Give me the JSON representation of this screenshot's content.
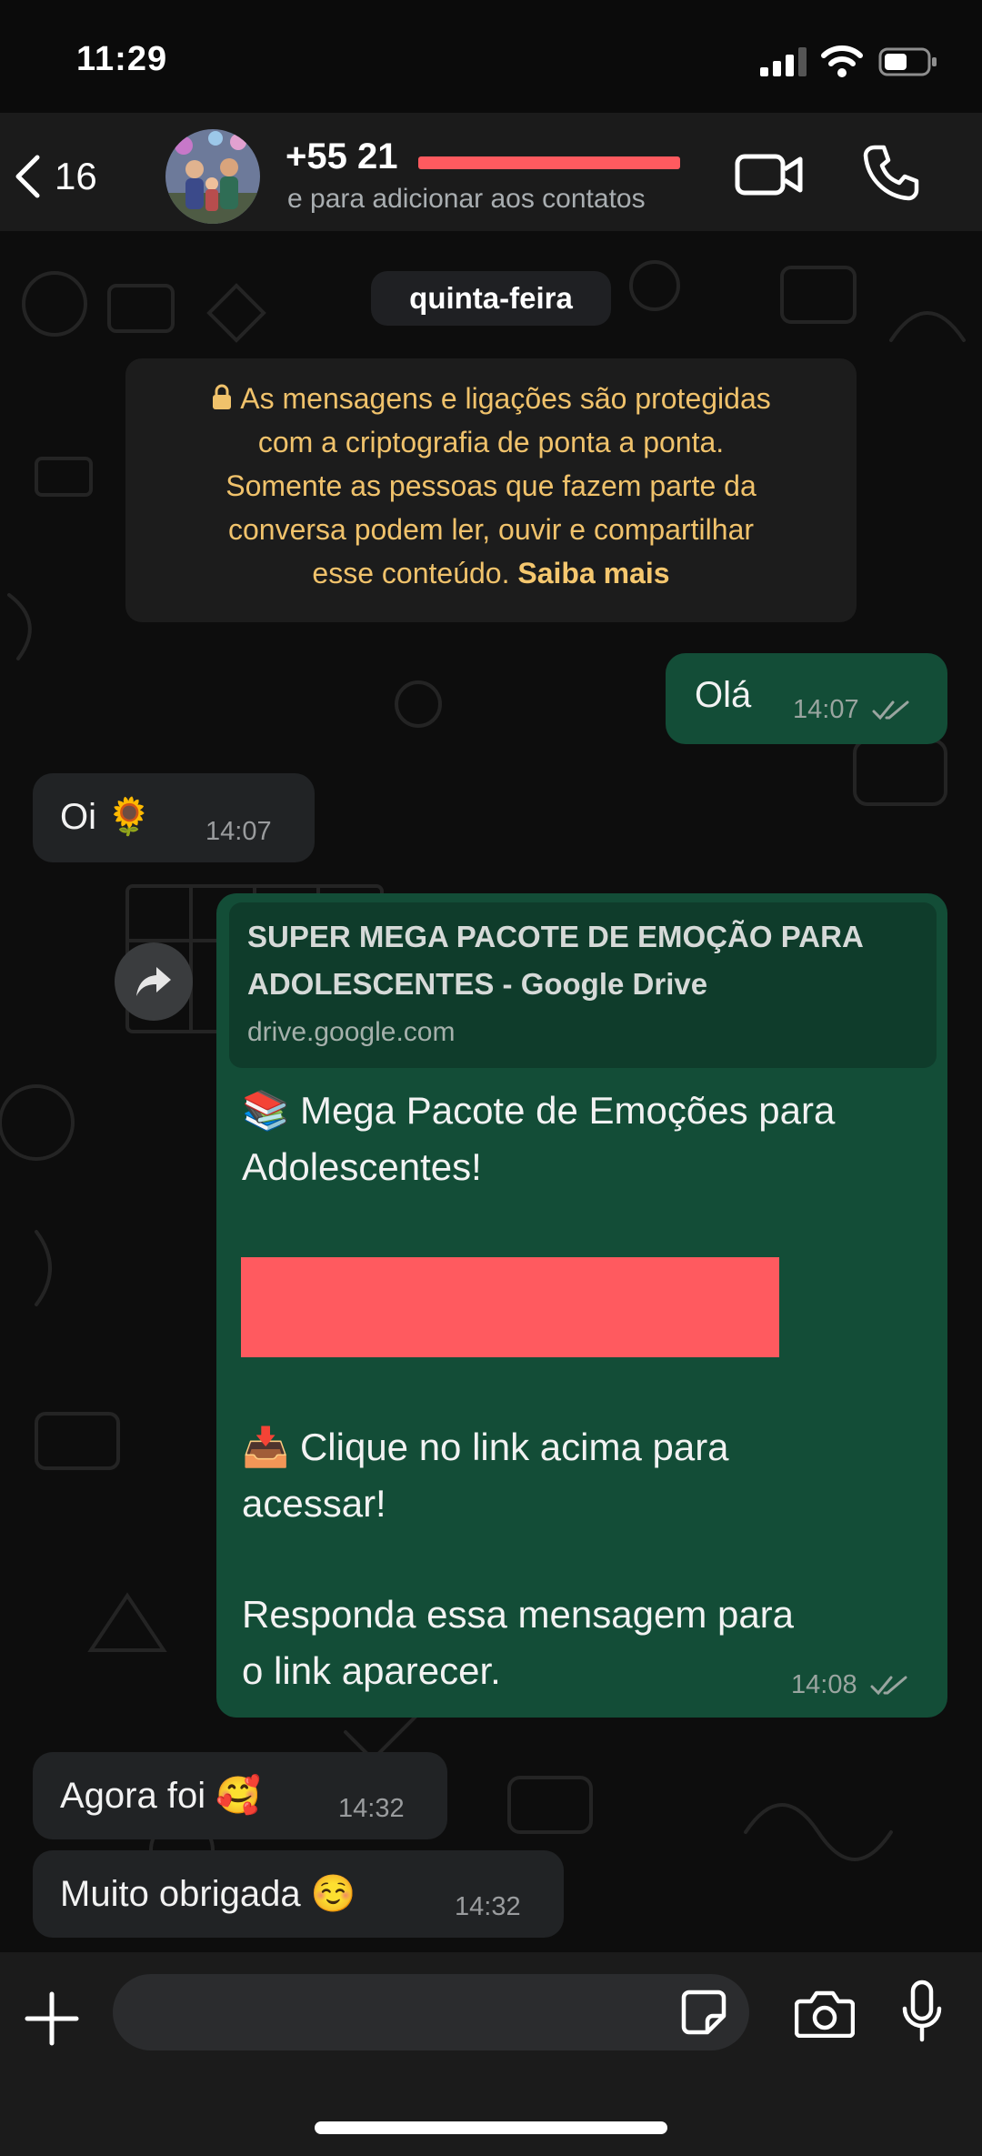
{
  "status_bar": {
    "time": "11:29"
  },
  "header": {
    "back_count": "16",
    "contact_name": "+55 21",
    "contact_subtitle": "e para adicionar aos contatos"
  },
  "chat": {
    "date_label": "quinta-feira",
    "encryption_notice": {
      "line1": "As mensagens e ligações são protegidas",
      "line2": "com a criptografia de ponta a ponta.",
      "line3": "Somente as pessoas que fazem parte da",
      "line4": "conversa podem ler, ouvir e compartilhar",
      "line5_prefix": "esse conteúdo. ",
      "learn_more": "Saiba mais"
    },
    "messages": [
      {
        "direction": "out",
        "text": "Olá",
        "time": "14:07"
      },
      {
        "direction": "in",
        "text": "Oi 🌻",
        "time": "14:07"
      },
      {
        "direction": "out",
        "link_preview": {
          "title_line1": "SUPER MEGA PACOTE DE EMOÇÃO PARA",
          "title_line2": "ADOLESCENTES - Google Drive",
          "domain": "drive.google.com"
        },
        "line1": "📚 Mega Pacote de Emoções para",
        "line2": "Adolescentes!",
        "line3": "📥 Clique no link acima para",
        "line4": "acessar!",
        "line5": "Responda essa mensagem para",
        "line6": "o link aparecer.",
        "time": "14:08"
      },
      {
        "direction": "in",
        "text": "Agora foi 🥰",
        "time": "14:32"
      },
      {
        "direction": "in",
        "text": "Muito obrigada ☺️",
        "time": "14:32"
      }
    ]
  },
  "icons": {
    "back": "chevron-left-icon",
    "video": "video-camera-icon",
    "call": "phone-icon",
    "forward": "forward-arrow-icon",
    "plus": "plus-icon",
    "sticker": "sticker-icon",
    "camera": "camera-icon",
    "mic": "microphone-icon"
  },
  "colors": {
    "outgoing_bubble": "#134d37",
    "incoming_bubble": "#212325",
    "encryption_text": "#f0c26b",
    "redaction": "#ff5a5f"
  }
}
